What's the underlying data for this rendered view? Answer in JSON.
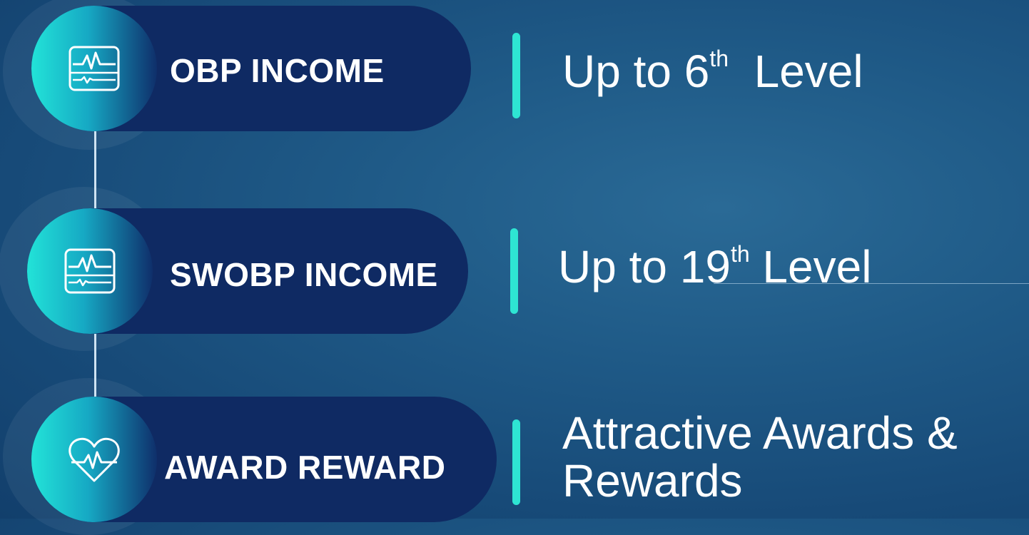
{
  "items": [
    {
      "label": "OBP INCOME",
      "icon": "heartbeat-monitor-icon",
      "description": {
        "prefix": "Up to 6",
        "sup": "th",
        "suffix": "  Level"
      }
    },
    {
      "label": "SWOBP INCOME",
      "icon": "heartbeat-monitor-icon",
      "description": {
        "prefix": "Up to 19",
        "sup": "th",
        "suffix": " Level"
      }
    },
    {
      "label": "AWARD REWARD",
      "icon": "heart-pulse-icon",
      "description": {
        "line1": "Attractive Awards &",
        "line2": "Rewards"
      }
    }
  ],
  "colors": {
    "accent": "#2ee5d3",
    "pill": "#0f2a63",
    "background": "#1f5a87"
  }
}
